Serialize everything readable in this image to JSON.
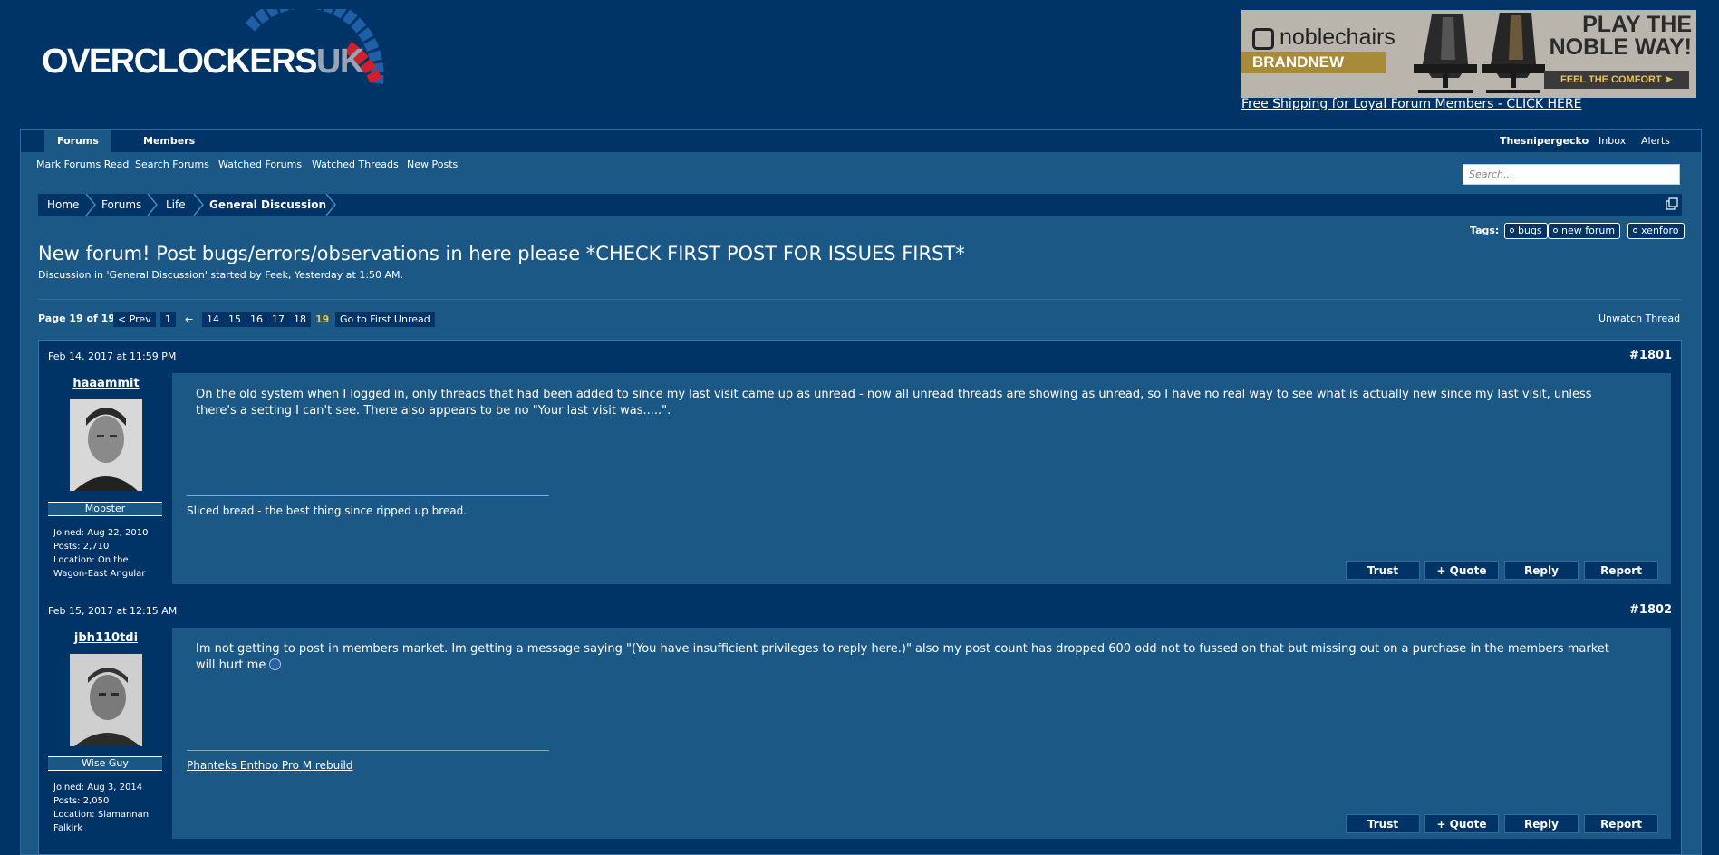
{
  "header": {
    "logo_main": "OVERCLOCKERS",
    "logo_suffix": "UK",
    "ad": {
      "brand": "noblechairs",
      "badge": "BRANDNEW",
      "tagline_1": "PLAY THE",
      "tagline_2": "NOBLE WAY!",
      "cta": "FEEL THE COMFORT",
      "link_text": "Free Shipping for Loyal Forum Members - CLICK HERE"
    }
  },
  "nav": {
    "tabs": [
      {
        "label": "Forums"
      },
      {
        "label": "Members"
      }
    ],
    "user": "Thesnipergecko",
    "inbox": "Inbox",
    "alerts": "Alerts",
    "sub_links": [
      "Mark Forums Read",
      "Search Forums",
      "Watched Forums",
      "Watched Threads",
      "New Posts"
    ],
    "search_placeholder": "Search..."
  },
  "breadcrumb": [
    "Home",
    "Forums",
    "Life",
    "General Discussion"
  ],
  "tags": {
    "label": "Tags:",
    "items": [
      "bugs",
      "new forum",
      "xenforo"
    ]
  },
  "thread": {
    "title": "New forum! Post bugs/errors/observations in here please *CHECK FIRST POST FOR ISSUES FIRST*",
    "meta": "Discussion in 'General Discussion' started by Feek, Yesterday at 1:50 AM."
  },
  "pagination": {
    "label": "Page 19 of 19",
    "prev": "< Prev",
    "first": "1",
    "arrow": "←",
    "pages": [
      "14",
      "15",
      "16",
      "17",
      "18",
      "19"
    ],
    "current": "19",
    "first_unread": "Go to First Unread",
    "unwatch": "Unwatch Thread"
  },
  "posts": [
    {
      "date": "Feb 14, 2017 at 11:59 PM",
      "number": "#1801",
      "username": "haaammit",
      "user_title": "Mobster",
      "joined": "Joined: Aug 22, 2010",
      "posts": "Posts: 2,710",
      "location_1": "Location: On the",
      "location_2": "Wagon-East Angular",
      "text": "On the old system when I logged in, only threads that had been added to since my last visit came up as unread - now all unread threads are showing as unread, so I have no real way to see what is actually new since my last visit, unless there's a setting I can't see. There also appears to be no \"Your last visit was.....\".",
      "signature": "Sliced bread - the best thing since ripped up bread."
    },
    {
      "date": "Feb 15, 2017 at 12:15 AM",
      "number": "#1802",
      "username": "jbh110tdi",
      "user_title": "Wise Guy",
      "joined": "Joined: Aug 3, 2014",
      "posts": "Posts: 2,050",
      "location_1": "Location: Slamannan",
      "location_2": "Falkirk",
      "text": "Im not getting to post in members market. Im getting a message saying \"(You have insufficient privileges to reply here.)\" also my post count has dropped 600 odd not to fussed on that but missing out on a purchase in the members market will hurt me",
      "signature": "Phanteks Enthoo Pro M rebuild"
    }
  ],
  "post_buttons": {
    "trust": "Trust",
    "quote": "+ Quote",
    "reply": "Reply",
    "report": "Report"
  },
  "icons": {
    "logo_arc": "speedometer-arc-icon",
    "popout": "popout-icon",
    "tag": "tag-icon",
    "smiley": "sad-smiley-icon"
  },
  "colors": {
    "page_bg": "#003366",
    "panel_bg": "#1c5885",
    "accent_red": "#d0202e",
    "current_page": "#e8c15a"
  }
}
